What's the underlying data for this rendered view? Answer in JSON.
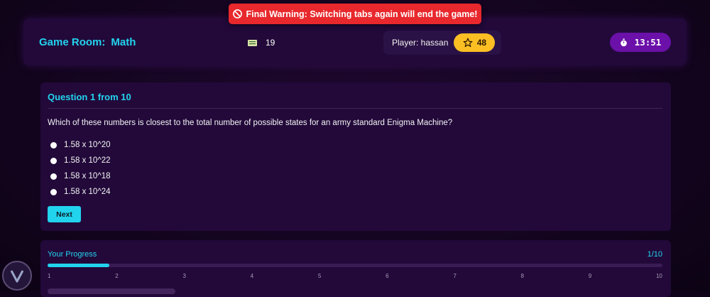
{
  "toast": {
    "message": "Final Warning: Switching tabs again will end the game!",
    "icon": "no-entry-icon",
    "color": "#e8282c"
  },
  "header": {
    "room_label": "Game Room:",
    "room_name": "Math",
    "question_count": "19",
    "player_label": "Player: hassan",
    "score": "48",
    "timer": "13:51"
  },
  "question": {
    "title": "Question 1 from 10",
    "text": "Which of these numbers is closest to the total number of possible states for an army standard Enigma Machine?",
    "options": [
      "1.58 x 10^20",
      "1.58 x 10^22",
      "1.58 x 10^18",
      "1.58 x 10^24"
    ],
    "next_label": "Next"
  },
  "progress": {
    "label": "Your Progress",
    "count": "1/10",
    "value": 0.1,
    "ticks": [
      "1",
      "2",
      "3",
      "4",
      "5",
      "6",
      "7",
      "8",
      "9",
      "10"
    ]
  },
  "colors": {
    "accent": "#22d3ee",
    "score": "#fbbf24",
    "timer": "#6b10a8",
    "panel": "#22093a"
  }
}
